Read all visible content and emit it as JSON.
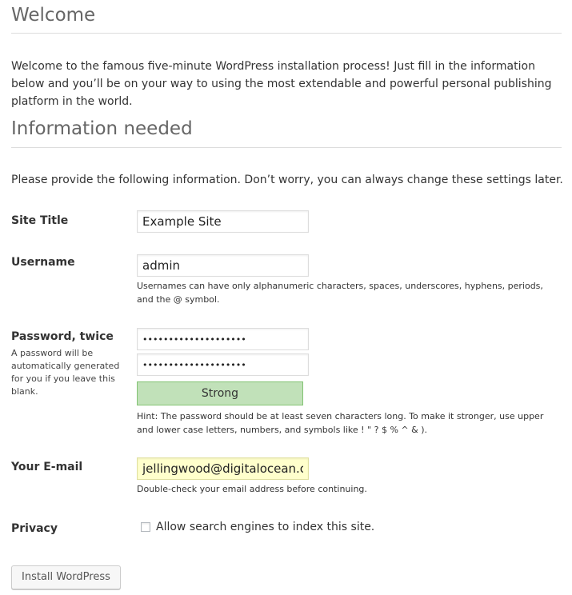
{
  "welcome": {
    "heading": "Welcome",
    "intro": "Welcome to the famous five-minute WordPress installation process! Just fill in the information below and you’ll be on your way to using the most extendable and powerful personal publishing platform in the world."
  },
  "info": {
    "heading": "Information needed",
    "lead": "Please provide the following information. Don’t worry, you can always change these settings later."
  },
  "form": {
    "site_title": {
      "label": "Site Title",
      "value": "Example Site"
    },
    "username": {
      "label": "Username",
      "value": "admin",
      "hint": "Usernames can have only alphanumeric characters, spaces, underscores, hyphens, periods, and the @ symbol."
    },
    "password": {
      "label": "Password, twice",
      "sublabel": "A password will be automatically generated for you if you leave this blank.",
      "value1": "••••••••••••••••••••",
      "value2": "••••••••••••••••••••",
      "strength": "Strong",
      "strength_color": "#c1e1b9",
      "hint": "Hint: The password should be at least seven characters long. To make it stronger, use upper and lower case letters, numbers, and symbols like ! \" ? $ % ^ & )."
    },
    "email": {
      "label": "Your E-mail",
      "value": "jellingwood@digitalocean.con",
      "hint": "Double-check your email address before continuing."
    },
    "privacy": {
      "label": "Privacy",
      "checkbox_label": "Allow search engines to index this site.",
      "checked": false
    },
    "submit_label": "Install WordPress"
  }
}
